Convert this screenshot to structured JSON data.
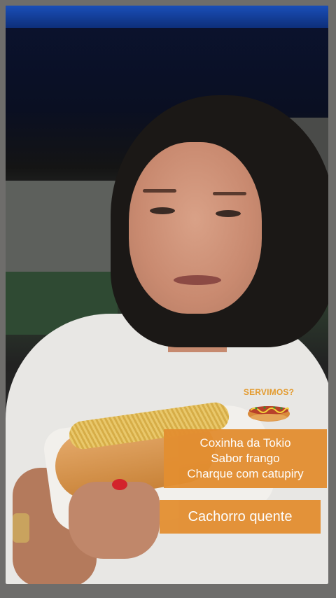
{
  "story": {
    "sticker": {
      "label": "SERVIMOS?",
      "icon": "hot-dog-icon"
    },
    "menu_box": {
      "lines": [
        "Coxinha da Tokio",
        "Sabor frango",
        "Charque com catupiry"
      ]
    },
    "hotdog_box": {
      "label": "Cachorro quente"
    },
    "colors": {
      "box_background": "#e38e30",
      "box_text": "#ffffff",
      "sticker_text": "#e39b2f"
    }
  }
}
